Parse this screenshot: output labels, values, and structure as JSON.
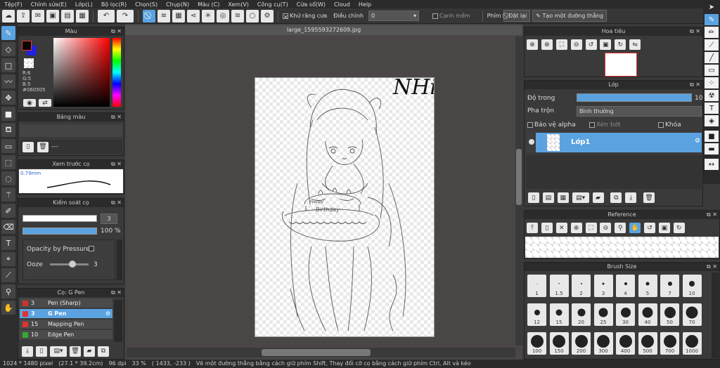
{
  "menu": [
    "Tệp(F)",
    "Chỉnh sửa(E)",
    "Lớp(L)",
    "Bộ lọc(R)",
    "Chọn(S)",
    "Chụp(N)",
    "Màu (C)",
    "Xem(V)",
    "Công cụ(T)",
    "Cửa sổ(W)",
    "Cloud",
    "Help"
  ],
  "toolbar": {
    "antialias": "Khử răng cưa",
    "adjust": "Điều chỉnh",
    "adjust_value": "0",
    "smooth": "Cạnh mềm",
    "pen": "Phím",
    "reset": "Đặt lại",
    "make_line": "Tạo một đường thẳng"
  },
  "color_panel": {
    "title": "Màu",
    "r": "R:6",
    "g": "G:5",
    "b": "B:5",
    "hex": "#060505"
  },
  "palette_panel": {
    "title": "Bảng màu",
    "empty": "---"
  },
  "preview_panel": {
    "title": "Xem trước cọ",
    "size": "0.79mm"
  },
  "control_panel": {
    "title": "Kiểm soát cọ",
    "size_value": "3",
    "opacity": "100 %",
    "opacity_pressure": "Opacity by Pressure",
    "ooze": "Ooze",
    "ooze_value": "3"
  },
  "brush_panel": {
    "title": "Cọ: G Pen",
    "brushes": [
      {
        "num": "3",
        "name": "Pen (Sharp)",
        "color": "#cc3333",
        "selected": false
      },
      {
        "num": "3",
        "name": "G Pen",
        "color": "#dd3333",
        "selected": true
      },
      {
        "num": "15",
        "name": "Mapping Pen",
        "color": "#dd3333",
        "selected": false
      },
      {
        "num": "10",
        "name": "Edge Pen",
        "color": "#33aa33",
        "selected": false
      }
    ]
  },
  "document": {
    "tab": "large_1595593272609.jpg",
    "signature": "NHi"
  },
  "navigator": {
    "title": "Hoa tiêu"
  },
  "layers": {
    "title": "Lớp",
    "opacity_label": "Độ trong",
    "opacity_value": "100",
    "blend_label": "Pha trộn",
    "blend_value": "Bình thường",
    "protect_alpha": "Bảo vệ alpha",
    "clip": "Xén bớt",
    "lock": "Khóa",
    "layer_name": "Lớp1"
  },
  "reference": {
    "title": "Reference"
  },
  "brush_size": {
    "title": "Brush Size",
    "sizes": [
      "1",
      "1.5",
      "2",
      "3",
      "4",
      "5",
      "7",
      "10",
      "12",
      "15",
      "20",
      "25",
      "30",
      "40",
      "50",
      "70",
      "100",
      "150",
      "200",
      "300",
      "400",
      "500",
      "700",
      "1000"
    ]
  },
  "status": {
    "dims": "1024 * 1480 pixel",
    "cm": "(27.1 * 39.2cm)",
    "dpi": "96 dpi",
    "zoom": "33 %",
    "coords": "( 1433, -233 )",
    "hint": "Vẽ một đường thẳng bằng cách giữ phím Shift, Thay đổi cỡ cọ bằng cách giữ phím Ctrl, Alt và kéo"
  }
}
